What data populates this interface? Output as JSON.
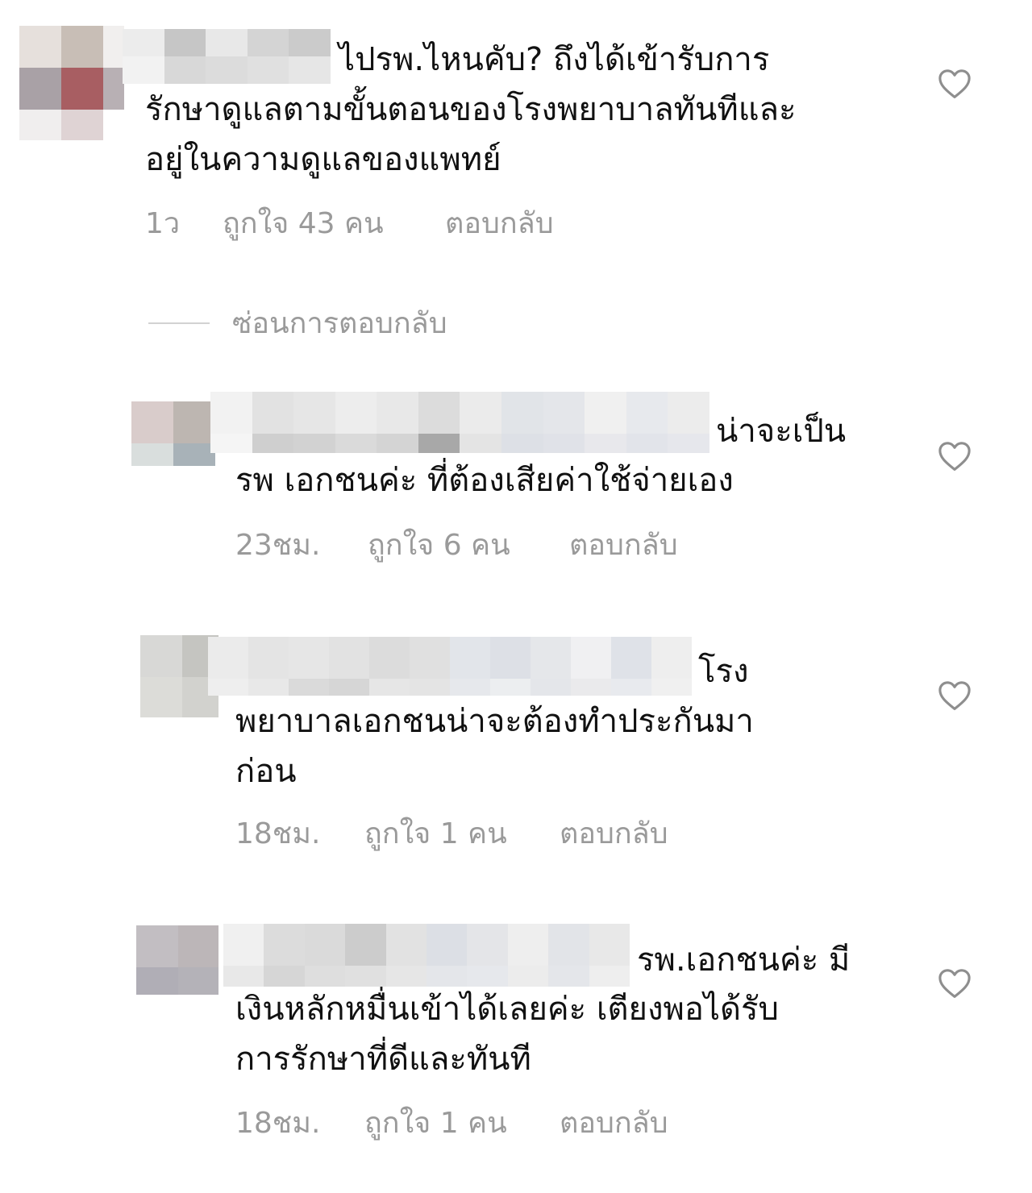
{
  "main_comment": {
    "text_lines": [
      "ไปรพ.ไหนคับ? ถึงได้เข้ารับการ",
      "รักษาดูแลตามขั้นตอนของโรงพยาบาลทันทีและ",
      "อยู่ในความดูแลของแพทย์"
    ],
    "time": "1ว",
    "likes": "ถูกใจ 43 คน",
    "reply": "ตอบกลับ"
  },
  "hide_replies_label": "ซ่อนการตอบกลับ",
  "replies": [
    {
      "text_lines": [
        "น่าจะเป็น",
        "รพ เอกชนค่ะ ที่ต้องเสียค่าใช้จ่ายเอง"
      ],
      "time": "23ชม.",
      "likes": "ถูกใจ 6 คน",
      "reply": "ตอบกลับ"
    },
    {
      "text_lines": [
        "โรง",
        "พยาบาลเอกชนน่าจะต้องทำประกันมา",
        "ก่อน"
      ],
      "time": "18ชม.",
      "likes": "ถูกใจ 1 คน",
      "reply": "ตอบกลับ"
    },
    {
      "text_lines": [
        "รพ.เอกชนค่ะ มี",
        "เงินหลักหมื่นเข้าได้เลยค่ะ เตียงพอได้รับ",
        "การรักษาที่ดีและทันที"
      ],
      "time": "18ชม.",
      "likes": "ถูกใจ 1 คน",
      "reply": "ตอบกลับ"
    }
  ],
  "icons": {
    "like": "heart-outline-icon"
  },
  "colors": {
    "text": "#111111",
    "muted": "#9a9a9a",
    "divider": "#d2d2d2"
  }
}
